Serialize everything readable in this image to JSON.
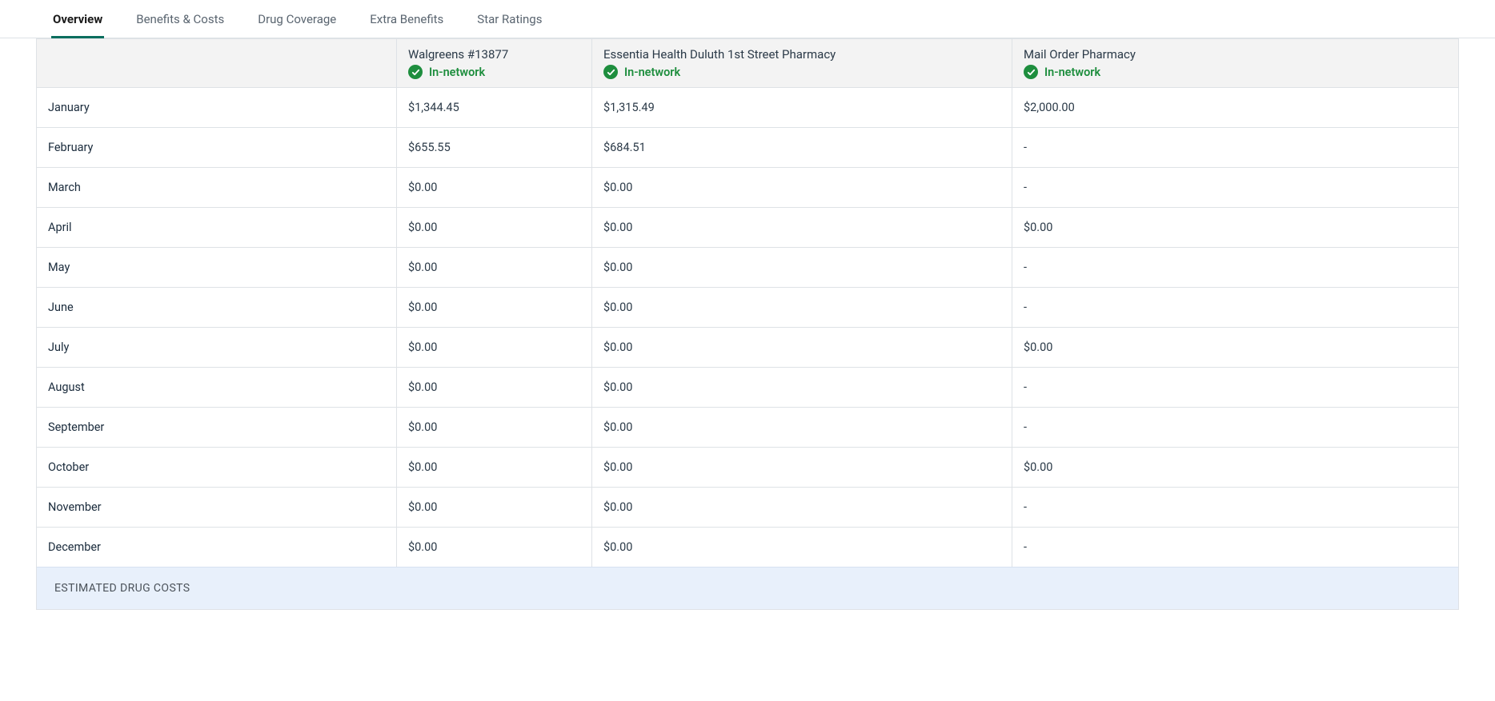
{
  "tabs": {
    "items": [
      {
        "label": "Overview",
        "active": true
      },
      {
        "label": "Benefits & Costs",
        "active": false
      },
      {
        "label": "Drug Coverage",
        "active": false
      },
      {
        "label": "Extra Benefits",
        "active": false
      },
      {
        "label": "Star Ratings",
        "active": false
      }
    ]
  },
  "pharmacies": [
    {
      "name": "Walgreens #13877",
      "status": "In-network"
    },
    {
      "name": "Essentia Health Duluth 1st Street Pharmacy",
      "status": "In-network"
    },
    {
      "name": "Mail Order Pharmacy",
      "status": "In-network"
    }
  ],
  "months": [
    {
      "label": "January",
      "values": [
        "$1,344.45",
        "$1,315.49",
        "$2,000.00"
      ]
    },
    {
      "label": "February",
      "values": [
        "$655.55",
        "$684.51",
        "-"
      ]
    },
    {
      "label": "March",
      "values": [
        "$0.00",
        "$0.00",
        "-"
      ]
    },
    {
      "label": "April",
      "values": [
        "$0.00",
        "$0.00",
        "$0.00"
      ]
    },
    {
      "label": "May",
      "values": [
        "$0.00",
        "$0.00",
        "-"
      ]
    },
    {
      "label": "June",
      "values": [
        "$0.00",
        "$0.00",
        "-"
      ]
    },
    {
      "label": "July",
      "values": [
        "$0.00",
        "$0.00",
        "$0.00"
      ]
    },
    {
      "label": "August",
      "values": [
        "$0.00",
        "$0.00",
        "-"
      ]
    },
    {
      "label": "September",
      "values": [
        "$0.00",
        "$0.00",
        "-"
      ]
    },
    {
      "label": "October",
      "values": [
        "$0.00",
        "$0.00",
        "$0.00"
      ]
    },
    {
      "label": "November",
      "values": [
        "$0.00",
        "$0.00",
        "-"
      ]
    },
    {
      "label": "December",
      "values": [
        "$0.00",
        "$0.00",
        "-"
      ]
    }
  ],
  "footer": {
    "label": "ESTIMATED DRUG COSTS"
  }
}
